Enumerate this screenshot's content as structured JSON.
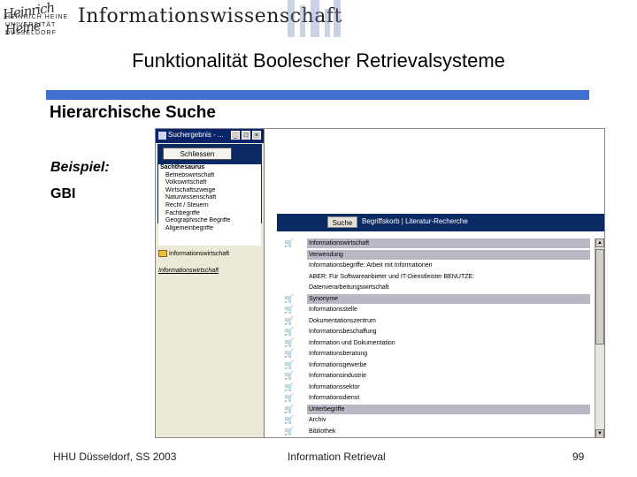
{
  "header": {
    "logo_signature": "Heinrich Heine",
    "logo_lines": [
      "HEINRICH HEINE",
      "UNIVERSITÄT",
      "DÜSSELDORF"
    ],
    "institute": "Informationswissenschaft"
  },
  "slide": {
    "title": "Funktionalität Boolescher Retrievalsysteme",
    "subtitle": "Hierarchische Suche",
    "beispiel": "Beispiel:",
    "gbi": "GBI",
    "accent_color": "#3f6fd0"
  },
  "screenshot": {
    "popup": {
      "title": "Suchergebnis - ...",
      "btn_min": "_",
      "btn_max": "□",
      "btn_close": "×",
      "close_label": "Schliessen",
      "tree_head": "Sachthesaurus",
      "tree_items": [
        "Betriebswirtschaft",
        "Volkswirtschaft",
        "Wirtschaftszweige",
        "Naturwissenschaft",
        "Recht / Steuern",
        "Fachbegriffe",
        "Geographische Begriffe",
        "Allgemeinbegriffe"
      ],
      "folder_item": "Informationswirtschaft",
      "folder_item2": "Informationswirtschaft"
    },
    "nav": {
      "suche_label": "Suche",
      "links": "Begriffskorb | Literatur-Recherche"
    },
    "rows": [
      {
        "text": "Informationswirtschaft",
        "shade": true,
        "cart": true
      },
      {
        "text": "Verwendung",
        "shade": true,
        "cart": false
      },
      {
        "text": "Informationsbegriffe: Arbeit mit Informationen",
        "shade": false,
        "cart": false
      },
      {
        "text": "ABER: Für Softwareanbieter und IT-Dienstleister BENUTZE:",
        "shade": false,
        "cart": false
      },
      {
        "text": "Datenverarbeitungswirtschaft",
        "shade": false,
        "cart": false
      },
      {
        "text": "Synonyme",
        "shade": true,
        "cart": true
      },
      {
        "text": "Informationsstelle",
        "shade": false,
        "cart": true
      },
      {
        "text": "Dokumentationszentrum",
        "shade": false,
        "cart": true
      },
      {
        "text": "Informationsbeschaffung",
        "shade": false,
        "cart": true
      },
      {
        "text": "Information und Dokumentation",
        "shade": false,
        "cart": true
      },
      {
        "text": "Informationsberatung",
        "shade": false,
        "cart": true
      },
      {
        "text": "Informationsgewerbe",
        "shade": false,
        "cart": true
      },
      {
        "text": "Informationsindustrie",
        "shade": false,
        "cart": true
      },
      {
        "text": "Informationssektor",
        "shade": false,
        "cart": true
      },
      {
        "text": "Informationsdienst",
        "shade": false,
        "cart": true
      },
      {
        "text": "Unterbegriffe",
        "shade": true,
        "cart": true
      },
      {
        "text": "Archiv",
        "shade": false,
        "cart": true
      },
      {
        "text": "Bibliothek",
        "shade": false,
        "cart": true
      }
    ],
    "scroll_up": "▲",
    "scroll_down": "▼"
  },
  "footer": {
    "left": "HHU Düsseldorf, SS 2003",
    "center": "Information Retrieval",
    "page": "99"
  }
}
